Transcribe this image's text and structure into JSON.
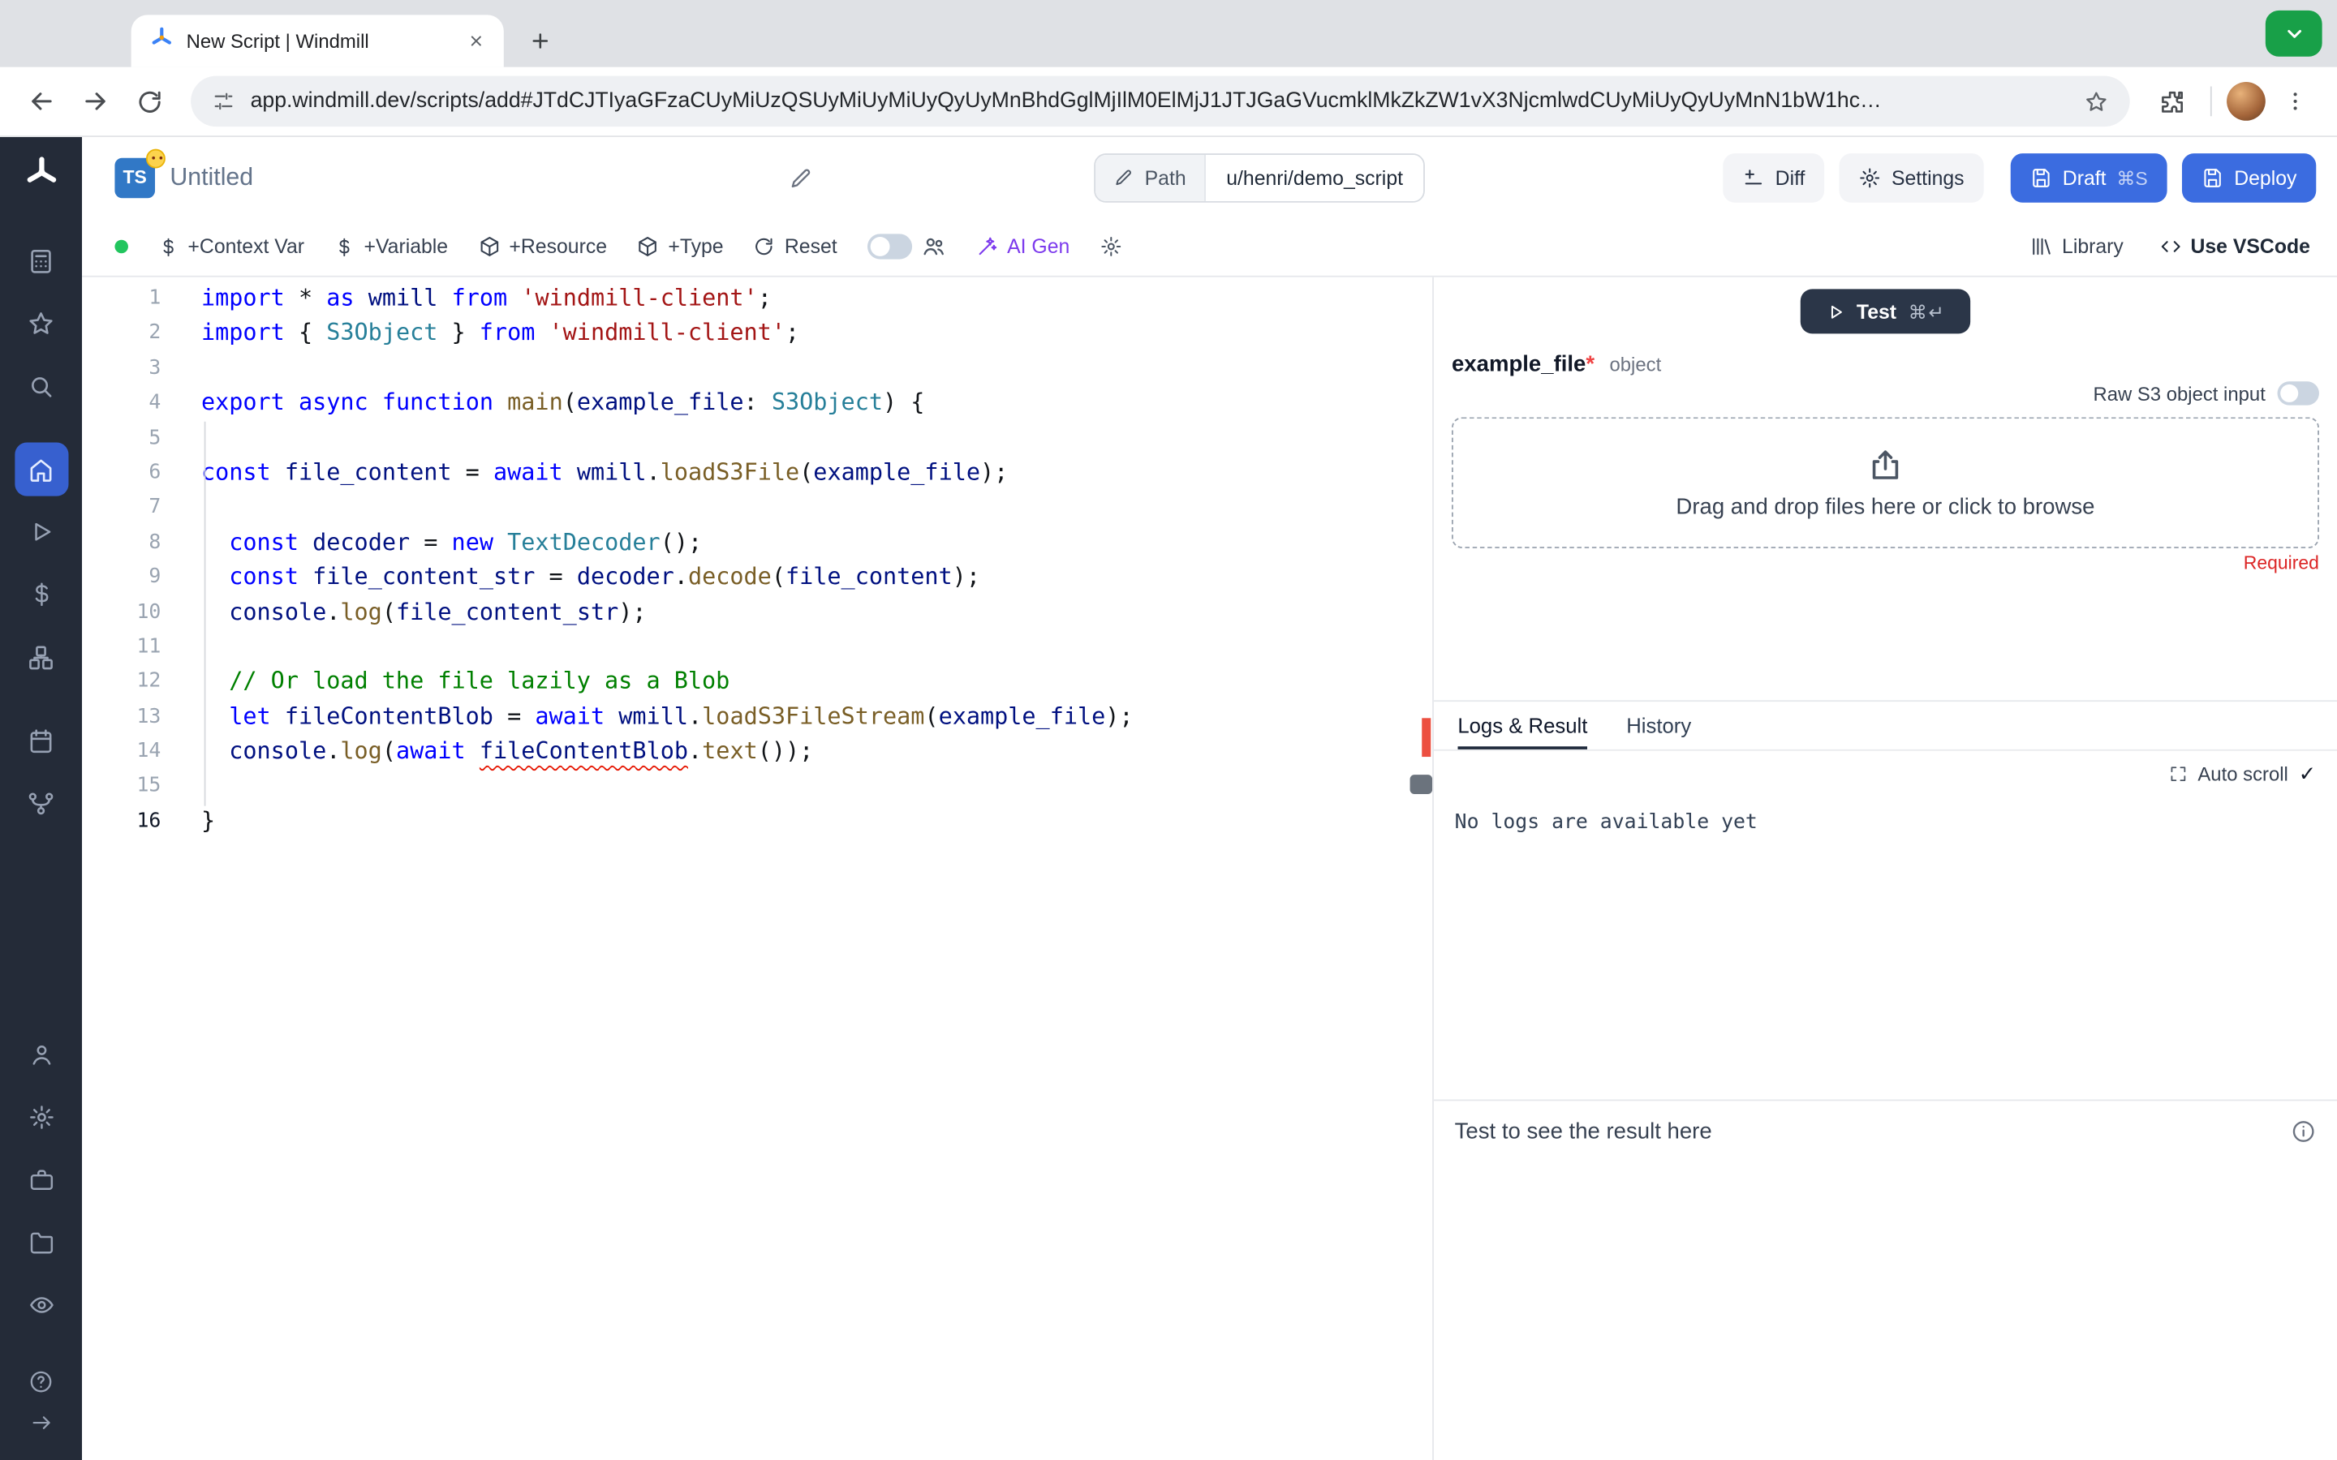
{
  "browser": {
    "tab_title": "New Script | Windmill",
    "url": "app.windmill.dev/scripts/add#JTdCJTIyaGFzaCUyMiUzQSUyMiUyMiUyQyUyMnBhdGglMjIlM0ElMjJ1JTJGaGVucmklMkZkZW1vX3NjcmlwdCUyMiUyQyUyMnN1bW1hc…"
  },
  "header": {
    "language_badge": "TS",
    "title": "Untitled",
    "path_label": "Path",
    "path_value": "u/henri/demo_script",
    "diff_label": "Diff",
    "settings_label": "Settings",
    "draft_label": "Draft",
    "draft_shortcut": "⌘S",
    "deploy_label": "Deploy"
  },
  "toolbar": {
    "context_var": "+Context Var",
    "variable": "+Variable",
    "resource": "+Resource",
    "type": "+Type",
    "reset": "Reset",
    "ai_gen": "AI Gen",
    "library": "Library",
    "vscode": "Use VSCode"
  },
  "editor": {
    "lines": [
      {
        "n": 1,
        "segs": [
          [
            "kw",
            "import"
          ],
          [
            "pl",
            " * "
          ],
          [
            "kw",
            "as"
          ],
          [
            "pl",
            " "
          ],
          [
            "var",
            "wmill"
          ],
          [
            "pl",
            " "
          ],
          [
            "kw",
            "from"
          ],
          [
            "pl",
            " "
          ],
          [
            "str",
            "'windmill-client'"
          ],
          [
            "pl",
            ";"
          ]
        ]
      },
      {
        "n": 2,
        "segs": [
          [
            "kw",
            "import"
          ],
          [
            "pl",
            " { "
          ],
          [
            "type",
            "S3Object"
          ],
          [
            "pl",
            " } "
          ],
          [
            "kw",
            "from"
          ],
          [
            "pl",
            " "
          ],
          [
            "str",
            "'windmill-client'"
          ],
          [
            "pl",
            ";"
          ]
        ]
      },
      {
        "n": 3,
        "segs": []
      },
      {
        "n": 4,
        "segs": [
          [
            "kw",
            "export"
          ],
          [
            "pl",
            " "
          ],
          [
            "kw",
            "async"
          ],
          [
            "pl",
            " "
          ],
          [
            "kw",
            "function"
          ],
          [
            "pl",
            " "
          ],
          [
            "fn",
            "main"
          ],
          [
            "pl",
            "("
          ],
          [
            "var",
            "example_file"
          ],
          [
            "pl",
            ": "
          ],
          [
            "type",
            "S3Object"
          ],
          [
            "pl",
            ") {"
          ]
        ]
      },
      {
        "n": 5,
        "segs": []
      },
      {
        "n": 6,
        "segs": [
          [
            "kw",
            "const"
          ],
          [
            "pl",
            " "
          ],
          [
            "var",
            "file_content"
          ],
          [
            "pl",
            " = "
          ],
          [
            "kw",
            "await"
          ],
          [
            "pl",
            " "
          ],
          [
            "var",
            "wmill"
          ],
          [
            "pl",
            "."
          ],
          [
            "fn",
            "loadS3File"
          ],
          [
            "pl",
            "("
          ],
          [
            "var",
            "example_file"
          ],
          [
            "pl",
            ");"
          ]
        ]
      },
      {
        "n": 7,
        "segs": []
      },
      {
        "n": 8,
        "segs": [
          [
            "pl",
            "  "
          ],
          [
            "kw",
            "const"
          ],
          [
            "pl",
            " "
          ],
          [
            "var",
            "decoder"
          ],
          [
            "pl",
            " = "
          ],
          [
            "kw",
            "new"
          ],
          [
            "pl",
            " "
          ],
          [
            "type",
            "TextDecoder"
          ],
          [
            "pl",
            "();"
          ]
        ]
      },
      {
        "n": 9,
        "segs": [
          [
            "pl",
            "  "
          ],
          [
            "kw",
            "const"
          ],
          [
            "pl",
            " "
          ],
          [
            "var",
            "file_content_str"
          ],
          [
            "pl",
            " = "
          ],
          [
            "var",
            "decoder"
          ],
          [
            "pl",
            "."
          ],
          [
            "fn",
            "decode"
          ],
          [
            "pl",
            "("
          ],
          [
            "var",
            "file_content"
          ],
          [
            "pl",
            ");"
          ]
        ]
      },
      {
        "n": 10,
        "segs": [
          [
            "pl",
            "  "
          ],
          [
            "var",
            "console"
          ],
          [
            "pl",
            "."
          ],
          [
            "fn",
            "log"
          ],
          [
            "pl",
            "("
          ],
          [
            "var",
            "file_content_str"
          ],
          [
            "pl",
            ");"
          ]
        ]
      },
      {
        "n": 11,
        "segs": []
      },
      {
        "n": 12,
        "segs": [
          [
            "pl",
            "  "
          ],
          [
            "com",
            "// Or load the file lazily as a Blob"
          ]
        ]
      },
      {
        "n": 13,
        "segs": [
          [
            "pl",
            "  "
          ],
          [
            "kw",
            "let"
          ],
          [
            "pl",
            " "
          ],
          [
            "var",
            "fileContentBlob"
          ],
          [
            "pl",
            " = "
          ],
          [
            "kw",
            "await"
          ],
          [
            "pl",
            " "
          ],
          [
            "var",
            "wmill"
          ],
          [
            "pl",
            "."
          ],
          [
            "fn",
            "loadS3FileStream"
          ],
          [
            "pl",
            "("
          ],
          [
            "var",
            "example_file"
          ],
          [
            "pl",
            ");"
          ]
        ]
      },
      {
        "n": 14,
        "segs": [
          [
            "pl",
            "  "
          ],
          [
            "var",
            "console"
          ],
          [
            "pl",
            "."
          ],
          [
            "fn",
            "log"
          ],
          [
            "pl",
            "("
          ],
          [
            "kw",
            "await"
          ],
          [
            "pl",
            " "
          ],
          [
            "var sq",
            "fileContentBlob"
          ],
          [
            "pl",
            "."
          ],
          [
            "fn",
            "text"
          ],
          [
            "pl",
            "());"
          ]
        ]
      },
      {
        "n": 15,
        "segs": []
      },
      {
        "n": 16,
        "active": true,
        "segs": [
          [
            "pl",
            "}"
          ]
        ]
      }
    ]
  },
  "run": {
    "test_label": "Test",
    "test_shortcut": "⌘↵",
    "arg_name": "example_file",
    "arg_required_marker": "*",
    "arg_type": "object",
    "raw_toggle_label": "Raw S3 object input",
    "dropzone_text": "Drag and drop files here or click to browse",
    "required_label": "Required"
  },
  "results": {
    "tabs": [
      {
        "label": "Logs & Result"
      },
      {
        "label": "History"
      }
    ],
    "auto_scroll_label": "Auto scroll",
    "auto_scroll_check": "✓",
    "logs_empty": "No logs are available yet",
    "result_placeholder": "Test to see the result here"
  },
  "colors": {
    "accent_blue": "#3b6ce0",
    "sidebar_dark": "#242b38",
    "sidebar_active_blue": "#3760cf",
    "status_green": "#22c55e",
    "ai_purple": "#7c3aed",
    "error_red": "#e51400",
    "required_red": "#dc2626",
    "chrome_green": "#18a048"
  }
}
